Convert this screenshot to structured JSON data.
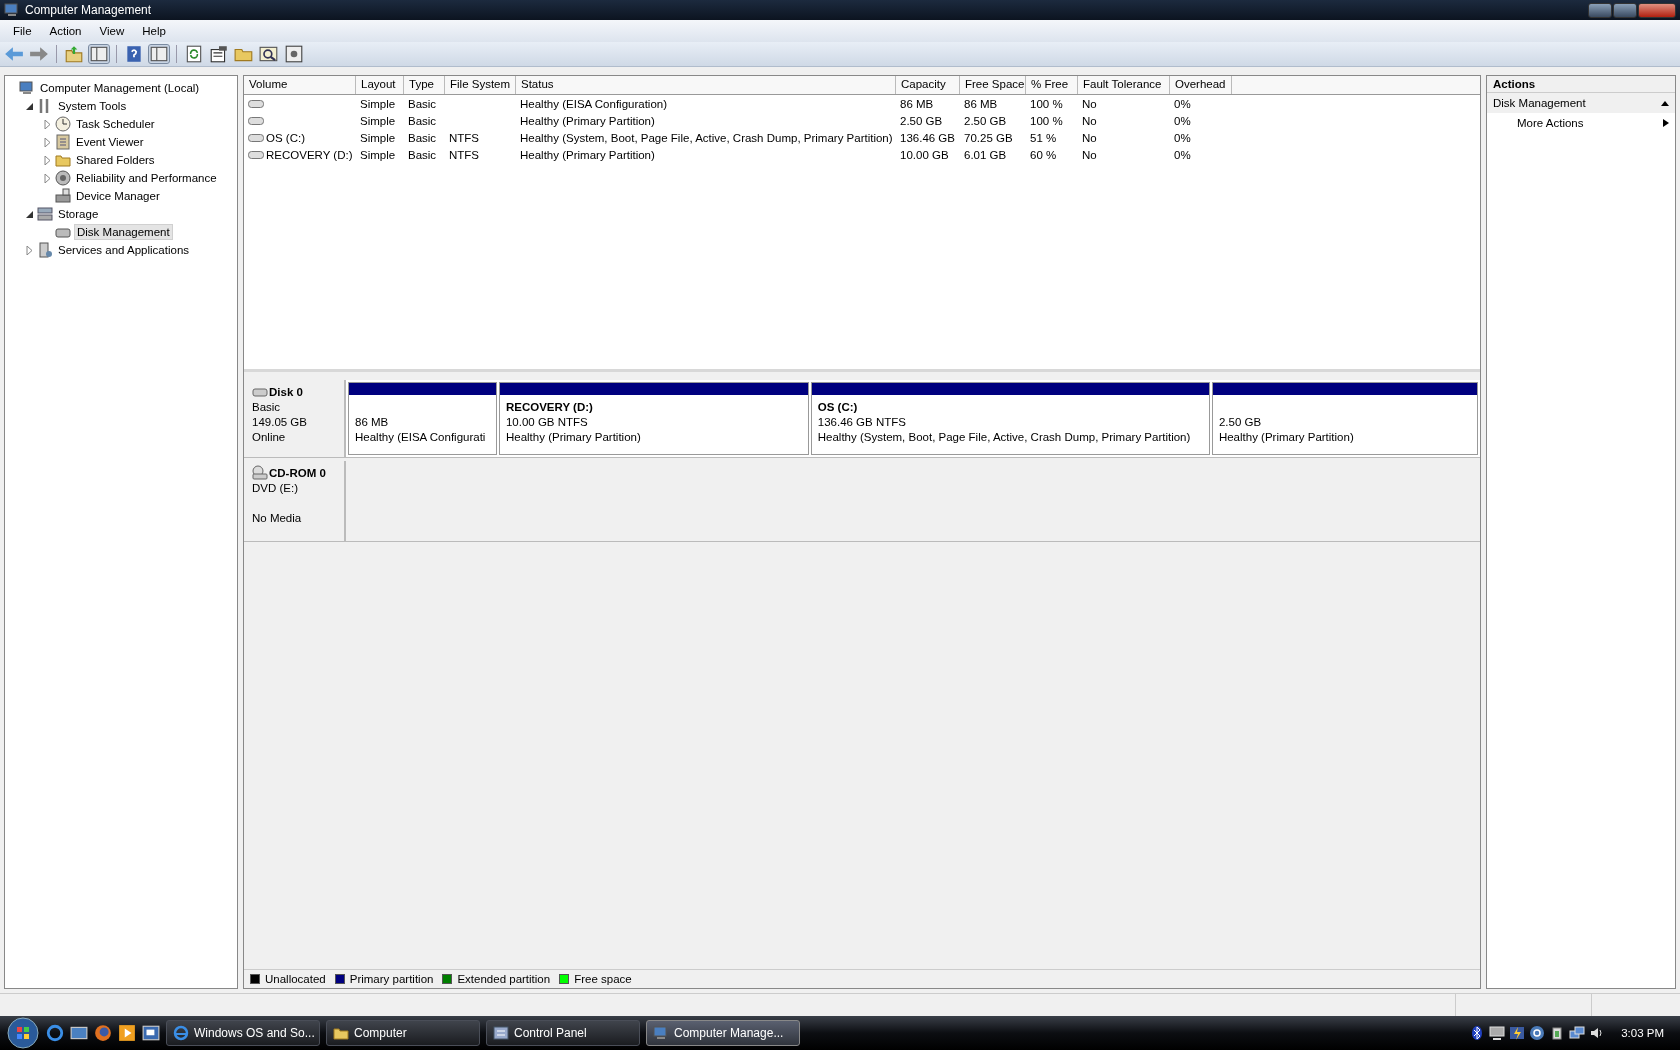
{
  "window": {
    "title": "Computer Management"
  },
  "menu": [
    "File",
    "Action",
    "View",
    "Help"
  ],
  "toolbar": [
    {
      "kind": "back"
    },
    {
      "kind": "forward"
    },
    {
      "kind": "sep"
    },
    {
      "kind": "up"
    },
    {
      "kind": "panel"
    },
    {
      "kind": "sep"
    },
    {
      "kind": "help"
    },
    {
      "kind": "panel"
    },
    {
      "kind": "sep"
    },
    {
      "kind": "refresh"
    },
    {
      "kind": "properties"
    },
    {
      "kind": "folder"
    },
    {
      "kind": "find"
    },
    {
      "kind": "settings"
    }
  ],
  "tree": [
    {
      "label": "Computer Management (Local)",
      "selected": false,
      "children": [
        {
          "label": "System Tools",
          "expanded": true,
          "selected": false,
          "children": [
            {
              "label": "Task Scheduler",
              "expanded": false,
              "selected": false
            },
            {
              "label": "Event Viewer",
              "expanded": false,
              "selected": false
            },
            {
              "label": "Shared Folders",
              "expanded": false,
              "selected": false
            },
            {
              "label": "Reliability and Performance",
              "expanded": false,
              "selected": false
            },
            {
              "label": "Device Manager",
              "selected": false
            }
          ]
        },
        {
          "label": "Storage",
          "expanded": true,
          "selected": false,
          "children": [
            {
              "label": "Disk Management",
              "selected": true
            }
          ]
        },
        {
          "label": "Services and Applications",
          "expanded": false,
          "selected": false
        }
      ]
    }
  ],
  "table": {
    "columns": [
      "Volume",
      "Layout",
      "Type",
      "File System",
      "Status",
      "Capacity",
      "Free Space",
      "% Free",
      "Fault Tolerance",
      "Overhead"
    ],
    "rows": [
      [
        "",
        "Simple",
        "Basic",
        "",
        "Healthy (EISA Configuration)",
        "86 MB",
        "86 MB",
        "100 %",
        "No",
        "0%"
      ],
      [
        "",
        "Simple",
        "Basic",
        "",
        "Healthy (Primary Partition)",
        "2.50 GB",
        "2.50 GB",
        "100 %",
        "No",
        "0%"
      ],
      [
        "OS (C:)",
        "Simple",
        "Basic",
        "NTFS",
        "Healthy (System, Boot, Page File, Active, Crash Dump, Primary Partition)",
        "136.46 GB",
        "70.25 GB",
        "51 %",
        "No",
        "0%"
      ],
      [
        "RECOVERY (D:)",
        "Simple",
        "Basic",
        "NTFS",
        "Healthy (Primary Partition)",
        "10.00 GB",
        "6.01 GB",
        "60 %",
        "No",
        "0%"
      ]
    ]
  },
  "disks": [
    {
      "kind": "disk",
      "name": "Disk 0",
      "lines": [
        "Basic",
        "149.05 GB",
        "Online"
      ],
      "partitions": [
        {
          "size": "86 MB",
          "status": "Healthy (EISA Configurati",
          "color": "#00007f"
        },
        {
          "name": "RECOVERY  (D:)",
          "size": "10.00 GB NTFS",
          "status": "Healthy (Primary Partition)",
          "color": "#00007f"
        },
        {
          "name": "OS  (C:)",
          "size": "136.46 GB NTFS",
          "status": "Healthy (System, Boot, Page File, Active, Crash Dump, Primary Partition)",
          "color": "#00007f"
        },
        {
          "size": "2.50 GB",
          "status": "Healthy (Primary Partition)",
          "color": "#00007f"
        }
      ]
    },
    {
      "kind": "cdrom",
      "name": "CD-ROM 0",
      "lines": [
        "DVD (E:)",
        "No Media"
      ]
    }
  ],
  "legend": [
    {
      "label": "Unallocated",
      "color": "#000000"
    },
    {
      "label": "Primary partition",
      "color": "#00007f"
    },
    {
      "label": "Extended partition",
      "color": "#007f00"
    },
    {
      "label": "Free space",
      "color": "#00ff00"
    }
  ],
  "actions": {
    "title": "Actions",
    "items": [
      {
        "kind": "header",
        "label": "Disk Management"
      },
      {
        "kind": "item",
        "label": "More Actions"
      }
    ]
  },
  "taskbar": {
    "buttons": [
      {
        "label": "Windows OS and So...",
        "selected": false
      },
      {
        "label": "Computer",
        "selected": false
      },
      {
        "label": "Control Panel",
        "selected": false
      },
      {
        "label": "Computer Manage...",
        "selected": true
      }
    ],
    "clock": "3:03 PM"
  }
}
